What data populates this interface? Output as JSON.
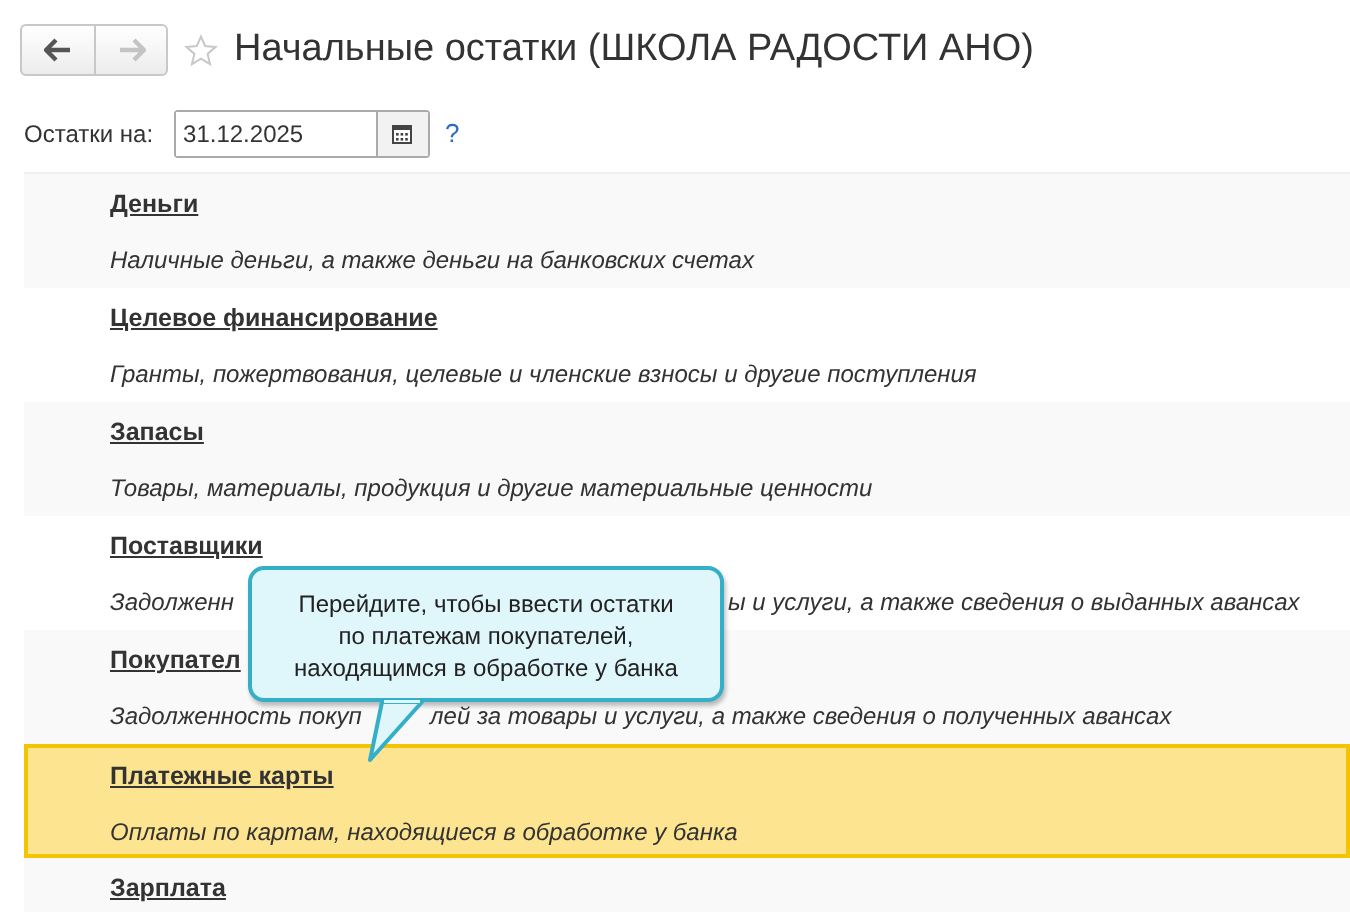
{
  "nav": {
    "back": {
      "disabled": false
    },
    "forward": {
      "disabled": true
    }
  },
  "favorite": false,
  "title": "Начальные остатки (ШКОЛА РАДОСТИ АНО)",
  "date_field": {
    "label": "Остатки на:",
    "value": "31.12.2025",
    "help": "?"
  },
  "sections": [
    {
      "title_parts": [
        "Деньги"
      ],
      "description_parts": [
        "Наличные деньги, а также деньги на банковских счетах"
      ],
      "selected": false
    },
    {
      "title_parts": [
        "Целевое финансирование"
      ],
      "description_parts": [
        "Гранты, пожертвования, целевые и членские взносы и другие поступления"
      ],
      "selected": false
    },
    {
      "title_parts": [
        "Запасы"
      ],
      "description_parts": [
        "Товары, материалы, продукция и другие материальные ценности"
      ],
      "selected": false
    },
    {
      "title_parts": [
        "Поставщики"
      ],
      "description_parts": [
        "Задолженн",
        "ы и услуги, а также сведения о выданных авансах"
      ],
      "selected": false
    },
    {
      "title_parts": [
        "Покупател"
      ],
      "description_parts": [
        "Задолженность покуп",
        "лей за товары и услуги, а также сведения о полученных авансах"
      ],
      "selected": false
    },
    {
      "title_parts": [
        "Платежные карты"
      ],
      "description_parts": [
        "Оплаты по картам, находящиеся в обработке у банка"
      ],
      "selected": true
    },
    {
      "title_parts": [
        "Зарплата"
      ],
      "selected": false
    }
  ],
  "tooltip": {
    "lines": [
      "Перейдите, чтобы ввести остатки",
      "по платежам покупателей,",
      "находящимся в обработке у банка"
    ]
  }
}
